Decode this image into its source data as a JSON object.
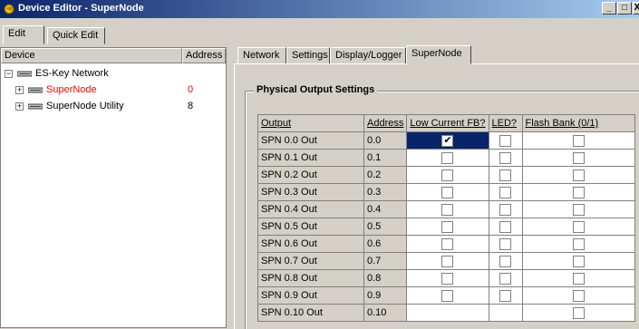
{
  "window": {
    "title": "Device Editor - SuperNode",
    "min": "_",
    "max": "□",
    "close": "X"
  },
  "top_tabs": [
    {
      "label": "Edit",
      "active": true
    },
    {
      "label": "Quick Edit",
      "active": false
    }
  ],
  "tree": {
    "col_device": "Device",
    "col_address": "Address",
    "root": "ES-Key Network",
    "nodes": [
      {
        "label": "SuperNode",
        "address": "0",
        "selected": true
      },
      {
        "label": "SuperNode Utility",
        "address": "8",
        "selected": false
      }
    ]
  },
  "right_tabs": [
    {
      "label": "Network"
    },
    {
      "label": "Settings"
    },
    {
      "label": "Display/Logger"
    },
    {
      "label": "SuperNode",
      "active": true
    }
  ],
  "group_title": "Physical Output Settings",
  "grid": {
    "headers": [
      "Output",
      "Address",
      "Low Current FB?",
      "LED?",
      "Flash Bank (0/1)"
    ],
    "rows": [
      {
        "output": "SPN 0.0 Out",
        "address": "0.0",
        "fb": true,
        "led": false,
        "flash": false
      },
      {
        "output": "SPN 0.1 Out",
        "address": "0.1",
        "fb": false,
        "led": false,
        "flash": false
      },
      {
        "output": "SPN 0.2 Out",
        "address": "0.2",
        "fb": false,
        "led": false,
        "flash": false
      },
      {
        "output": "SPN 0.3 Out",
        "address": "0.3",
        "fb": false,
        "led": false,
        "flash": false
      },
      {
        "output": "SPN 0.4 Out",
        "address": "0.4",
        "fb": false,
        "led": false,
        "flash": false
      },
      {
        "output": "SPN 0.5 Out",
        "address": "0.5",
        "fb": false,
        "led": false,
        "flash": false
      },
      {
        "output": "SPN 0.6 Out",
        "address": "0.6",
        "fb": false,
        "led": false,
        "flash": false
      },
      {
        "output": "SPN 0.7 Out",
        "address": "0.7",
        "fb": false,
        "led": false,
        "flash": false
      },
      {
        "output": "SPN 0.8 Out",
        "address": "0.8",
        "fb": false,
        "led": false,
        "flash": false
      },
      {
        "output": "SPN 0.9 Out",
        "address": "0.9",
        "fb": false,
        "led": false,
        "flash": false
      },
      {
        "output": "SPN 0.10 Out",
        "address": "0.10",
        "fb": null,
        "led": null,
        "flash": false
      }
    ]
  },
  "colors": {
    "selected_tree_text": "#ff0000",
    "selection": "#0a246a",
    "titlebar_start": "#0a246a",
    "titlebar_end": "#a6caf0"
  },
  "icons": {
    "app": "device-editor-icon",
    "device": "device-icon",
    "expand": "plus-expander-icon",
    "collapse": "minus-expander-icon",
    "check": "checkmark-icon"
  }
}
